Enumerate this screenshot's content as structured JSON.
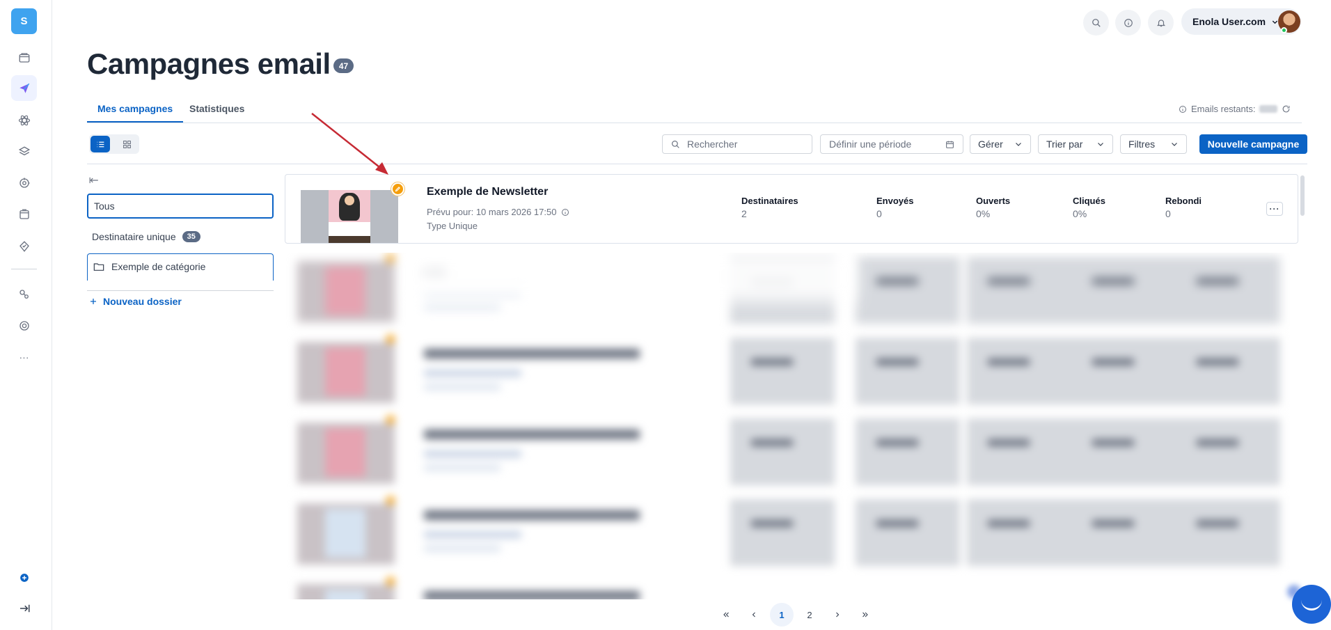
{
  "rail": {
    "logo_letter": "S",
    "icons": [
      "folder-icon",
      "send-icon",
      "atom-icon",
      "layers-icon",
      "target-icon",
      "window-icon",
      "badge-icon",
      "integrations-icon",
      "support-icon",
      "more-icon",
      "add-circle-icon",
      "logout-icon"
    ],
    "more_label": "···"
  },
  "header": {
    "user_name": "Enola User.com"
  },
  "page": {
    "title": "Campagnes email",
    "count": "47"
  },
  "tabs": [
    {
      "label": "Mes campagnes"
    },
    {
      "label": "Statistiques"
    }
  ],
  "emails_left_label": "Emails restants:",
  "toolbar": {
    "search_placeholder": "Rechercher",
    "period_placeholder": "Définir une période",
    "manage_label": "Gérer",
    "sort_label": "Trier par",
    "filters_label": "Filtres",
    "new_campaign_label": "Nouvelle campagne"
  },
  "folders": {
    "all_label": "Tous",
    "single_label": "Destinataire unique",
    "single_count": "35",
    "category_label": "Exemple de catégorie",
    "new_folder_label": "Nouveau dossier"
  },
  "campaign": {
    "name": "Exemple de Newsletter",
    "scheduled": "Prévu pour: 10 mars 2026 17:50",
    "type": "Type Unique",
    "stats": [
      {
        "label": "Destinataires",
        "value": "2"
      },
      {
        "label": "Envoyés",
        "value": "0"
      },
      {
        "label": "Ouverts",
        "value": "0%"
      },
      {
        "label": "Cliqués",
        "value": "0%"
      },
      {
        "label": "Rebondi",
        "value": "0"
      }
    ],
    "more_label": "···"
  },
  "pagination": {
    "pages": [
      "1",
      "2"
    ],
    "current": "1"
  },
  "colors": {
    "primary": "#0b63c5",
    "badge": "#5b6b85",
    "edit_dot": "#f59e0b",
    "annotation_arrow": "#c62a34"
  }
}
